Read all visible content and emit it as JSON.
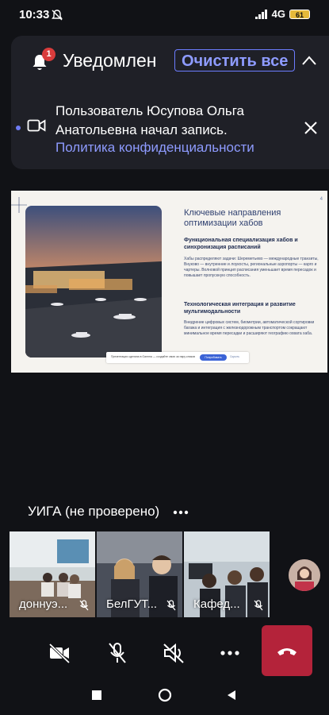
{
  "status_bar": {
    "time": "10:33",
    "network": "4G",
    "battery": "61"
  },
  "notification_panel": {
    "title": "Уведомлен",
    "badge_count": "1",
    "clear_all_label": "Очистить все",
    "message": "Пользователь Юсупова Ольга Анатольевна начал запись.",
    "link": "Политика конфиденциальности"
  },
  "slide": {
    "page_number": "4",
    "title": "Ключевые направления оптимизации хабов",
    "section1_title": "Функциональная специализация хабов и синхронизация расписаний",
    "section1_text": "Хабы распределяют задачи: Шереметьево — международные транзиты, Внуково — внутренние и лоукосты, региональные аэропорты — карго и чартеры. Волновой принцип расписания уменьшает время пересадок и повышает пропускную способность.",
    "section2_title": "Технологическая интеграция и развитие мультимодальности",
    "section2_text": "Внедрение цифровых систем, биометрии, автоматической сортировки багажа и интеграция с железнодорожным транспортом сокращают минимальное время пересадки и расширяют географию охвата хаба.",
    "banner_text": "Презентация сделана в Gamma — создайте свою за пару кликов",
    "banner_button": "Попробовать",
    "banner_close": "Скрыть"
  },
  "participants": {
    "speaker_name": "УИГА (не проверено)",
    "tiles": [
      {
        "label": "доннуэ..."
      },
      {
        "label": "БелГУТ..."
      },
      {
        "label": "Кафед..."
      }
    ]
  },
  "colors": {
    "accent": "#8e9bff",
    "end_call": "#b4233a",
    "badge": "#d93c3c"
  }
}
